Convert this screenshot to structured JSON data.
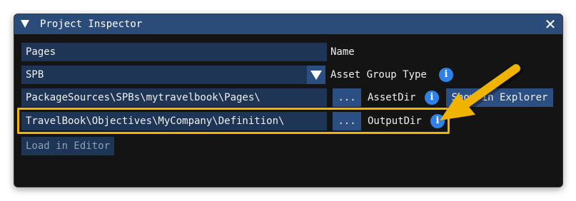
{
  "window": {
    "title": "Project Inspector"
  },
  "rows": {
    "name": {
      "value": "Pages",
      "label": "Name"
    },
    "asset_group_type": {
      "selected": "SPB",
      "label": "Asset Group Type"
    },
    "asset_dir": {
      "value": "PackageSources\\SPBs\\mytravelbook\\Pages\\",
      "browse_label": "...",
      "label": "AssetDir",
      "explorer_label": "Show in Explorer"
    },
    "output_dir": {
      "value": "TravelBook\\Objectives\\MyCompany\\Definition\\",
      "browse_label": "...",
      "label": "OutputDir"
    }
  },
  "actions": {
    "load_in_editor": "Load in Editor"
  },
  "icons": {
    "collapse": "triangle-down-icon",
    "close": "close-icon",
    "info": "info-icon",
    "dropdown": "chevron-down-icon",
    "annotation": "arrow-pointer"
  },
  "colors": {
    "titlebar": "#2b4b78",
    "field": "#1e3556",
    "button": "#2c4f83",
    "info": "#2f80e8",
    "highlight": "#f0b400"
  }
}
